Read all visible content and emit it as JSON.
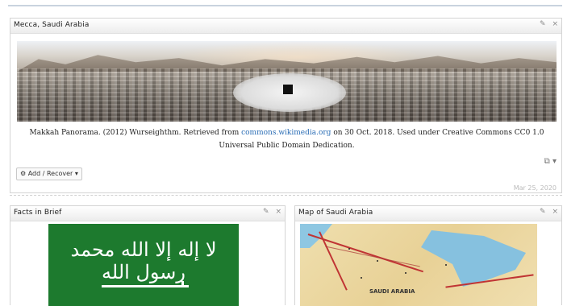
{
  "panels": {
    "main": {
      "title": "Mecca, Saudi Arabia",
      "tools": {
        "edit": "✎",
        "close": "×"
      },
      "caption": {
        "before_link": "Makkah Panorama. (2012) Wurseighthm. Retrieved from ",
        "link": "commons.wikimedia.org",
        "after_link": " on 30 Oct. 2018. Used under Creative Commons CC0 1.0",
        "line2": "Universal Public Domain Dedication."
      },
      "share_icon": "⧉ ▾",
      "add_button": "⚙ Add / Recover ▾",
      "date": "Mar 25, 2020"
    },
    "facts": {
      "title": "Facts in Brief",
      "tools": {
        "edit": "✎",
        "close": "×"
      },
      "flag_text": "لا إله إلا الله محمد رسول الله"
    },
    "map": {
      "title": "Map of Saudi Arabia",
      "tools": {
        "edit": "✎",
        "close": "×"
      },
      "map_label": "SAUDI ARABIA"
    }
  },
  "colors": {
    "flag_green": "#1d7a2e",
    "link": "#2a6db5",
    "border_red": "#c03434"
  }
}
